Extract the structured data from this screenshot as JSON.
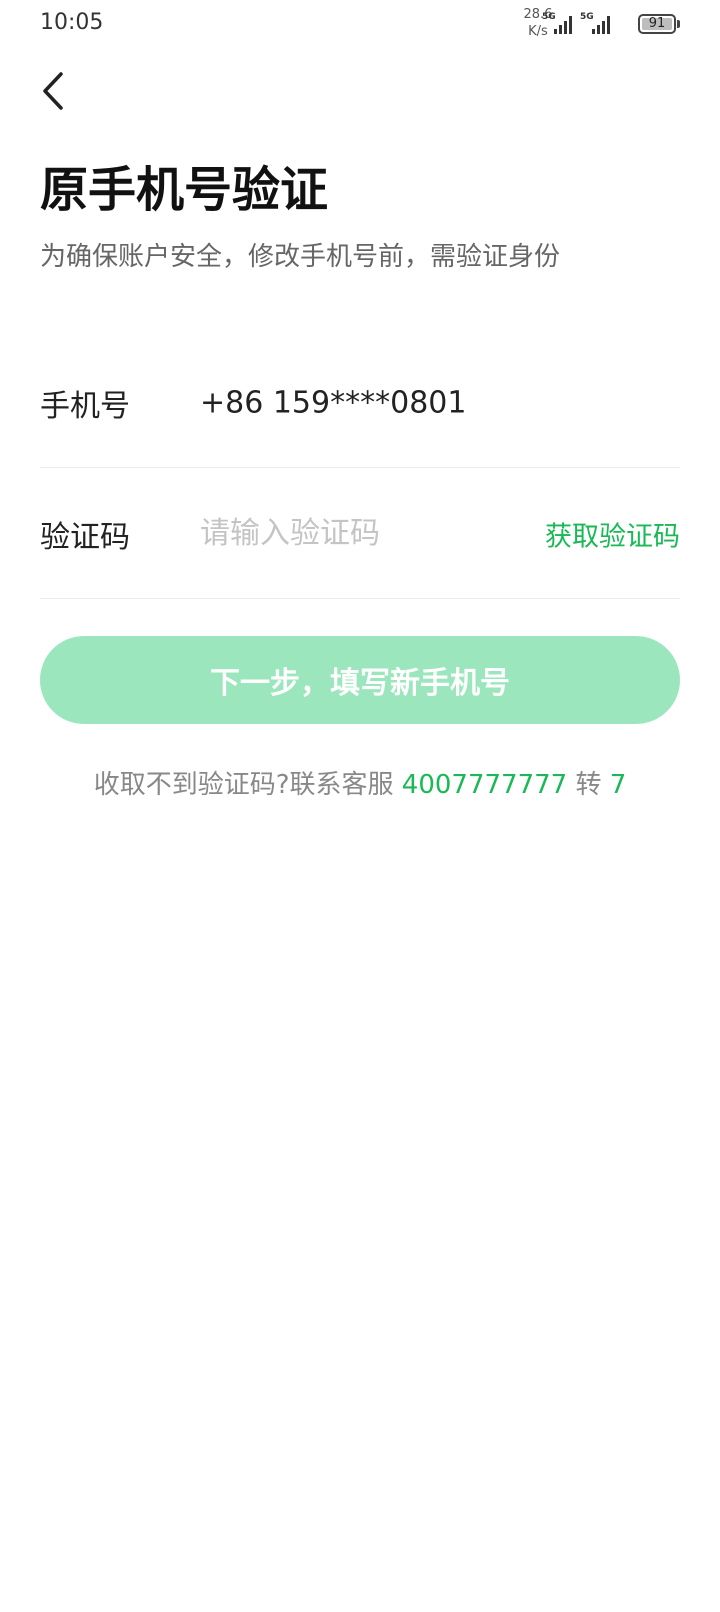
{
  "status_bar": {
    "time": "10:05",
    "net_speed_value": "28.6",
    "net_speed_unit": "K/s",
    "signal1_label": "5G",
    "signal2_label": "5G",
    "battery_level": "91"
  },
  "header": {
    "back_icon": "chevron-left-icon",
    "title": "原手机号验证",
    "subtitle": "为确保账户安全，修改手机号前，需验证身份"
  },
  "form": {
    "phone_label": "手机号",
    "phone_value": "+86 159****0801",
    "code_label": "验证码",
    "code_value": "",
    "code_placeholder": "请输入验证码",
    "get_code_label": "获取验证码"
  },
  "next_button_label": "下一步，填写新手机号",
  "help": {
    "text": "收取不到验证码?联系客服",
    "phone": "4007777777",
    "ext_text": "转",
    "ext": "7"
  },
  "colors": {
    "accent": "#19b955",
    "button_disabled": "#9be6bc"
  }
}
